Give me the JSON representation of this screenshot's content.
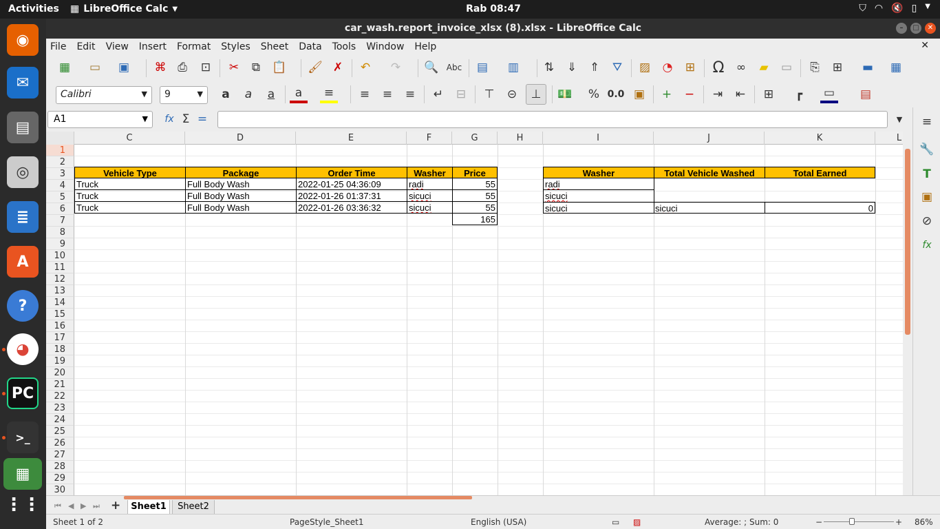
{
  "topbar": {
    "activities": "Activities",
    "app": "LibreOffice Calc",
    "clock": "Rab 08:47"
  },
  "window": {
    "title": "car_wash.report_invoice_xlsx (8).xlsx - LibreOffice Calc"
  },
  "menu": [
    "File",
    "Edit",
    "View",
    "Insert",
    "Format",
    "Styles",
    "Sheet",
    "Data",
    "Tools",
    "Window",
    "Help"
  ],
  "format_bar": {
    "font_name": "Calibri",
    "font_size": "9"
  },
  "formula_bar": {
    "cell_ref": "A1",
    "formula": ""
  },
  "columns": [
    "C",
    "D",
    "E",
    "F",
    "G",
    "H",
    "I",
    "J",
    "K",
    "L"
  ],
  "rows": [
    "1",
    "2",
    "3",
    "4",
    "5",
    "6",
    "7",
    "8",
    "9",
    "10",
    "11",
    "12",
    "13",
    "14",
    "15",
    "16",
    "17",
    "18",
    "19",
    "20",
    "21",
    "22",
    "23",
    "24",
    "25",
    "26",
    "27",
    "28",
    "29",
    "30"
  ],
  "table1": {
    "headers": [
      "Vehicle Type",
      "Package",
      "Order Time",
      "Washer",
      "Price"
    ],
    "rows": [
      [
        "Truck",
        "Full Body Wash",
        "2022-01-25 04:36:09",
        "radi",
        "55"
      ],
      [
        "Truck",
        "Full Body Wash",
        "2022-01-26 01:37:31",
        "sicuci",
        "55"
      ],
      [
        "Truck",
        "Full Body Wash",
        "2022-01-26 03:36:32",
        "sicuci",
        "55"
      ]
    ],
    "total": "165"
  },
  "table2": {
    "headers": [
      "Washer",
      "Total Vehicle Washed",
      "Total Earned"
    ],
    "rows": [
      [
        "radi",
        "",
        ""
      ],
      [
        "sicuci",
        "",
        ""
      ],
      [
        "sicuci",
        "sicuci",
        "0"
      ]
    ]
  },
  "sheets": [
    "Sheet1",
    "Sheet2"
  ],
  "active_sheet": "Sheet1",
  "status": {
    "sheet": "Sheet 1 of 2",
    "page_style": "PageStyle_Sheet1",
    "language": "English (USA)",
    "sum": "Average: ; Sum: 0",
    "zoom": "86%"
  },
  "colors": {
    "header_fill": "#ffc000",
    "accent": "#e95420"
  }
}
